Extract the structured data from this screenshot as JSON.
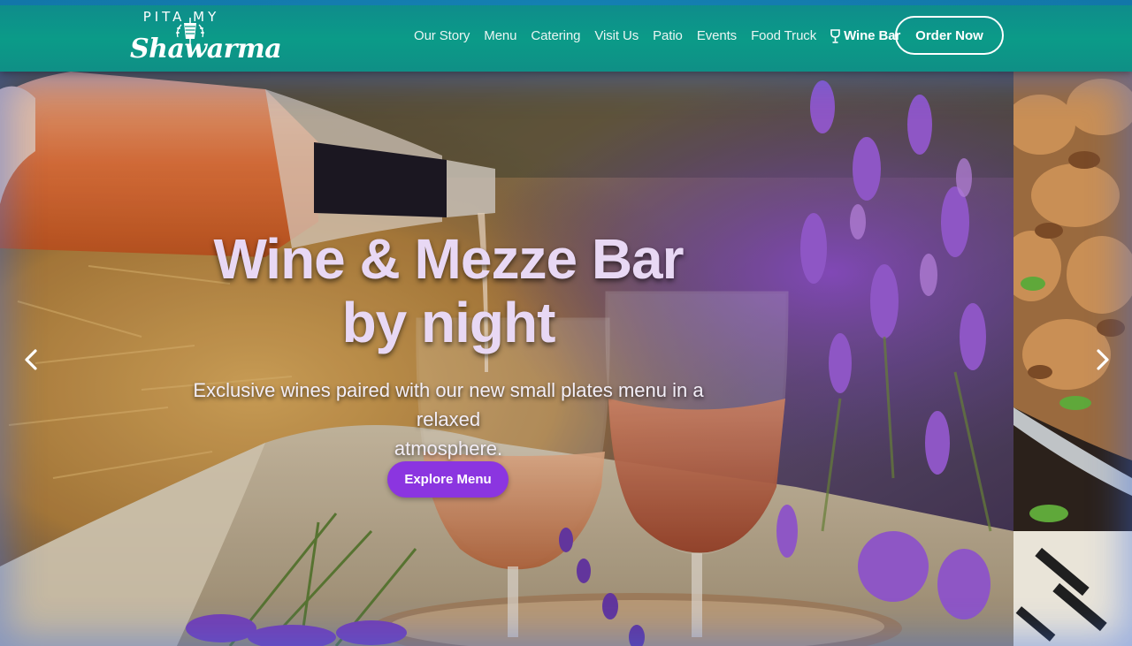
{
  "brand": {
    "top_text": "PITA MY",
    "script_text": "Shawarma",
    "emblem_icon": "shawarma-spit-icon"
  },
  "nav": {
    "items": [
      {
        "label": "Our Story"
      },
      {
        "label": "Menu"
      },
      {
        "label": "Catering"
      },
      {
        "label": "Visit Us"
      },
      {
        "label": "Patio"
      },
      {
        "label": "Events"
      },
      {
        "label": "Food Truck"
      }
    ],
    "active": {
      "label": "Wine Bar",
      "icon": "wine-glass-icon"
    },
    "order_button": "Order Now"
  },
  "hero": {
    "title_line1": "Wine & Mezze Bar",
    "title_line2": "by night",
    "subtitle_line1": "Exclusive wines paired with our new small plates menu in a relaxed",
    "subtitle_line2": "atmosphere.",
    "cta": "Explore Menu",
    "prev_icon": "chevron-left-icon",
    "next_icon": "chevron-right-icon"
  },
  "colors": {
    "header": "#0b9b88",
    "accent_button": "#8b35e0",
    "title_text": "#e8d8f4"
  }
}
